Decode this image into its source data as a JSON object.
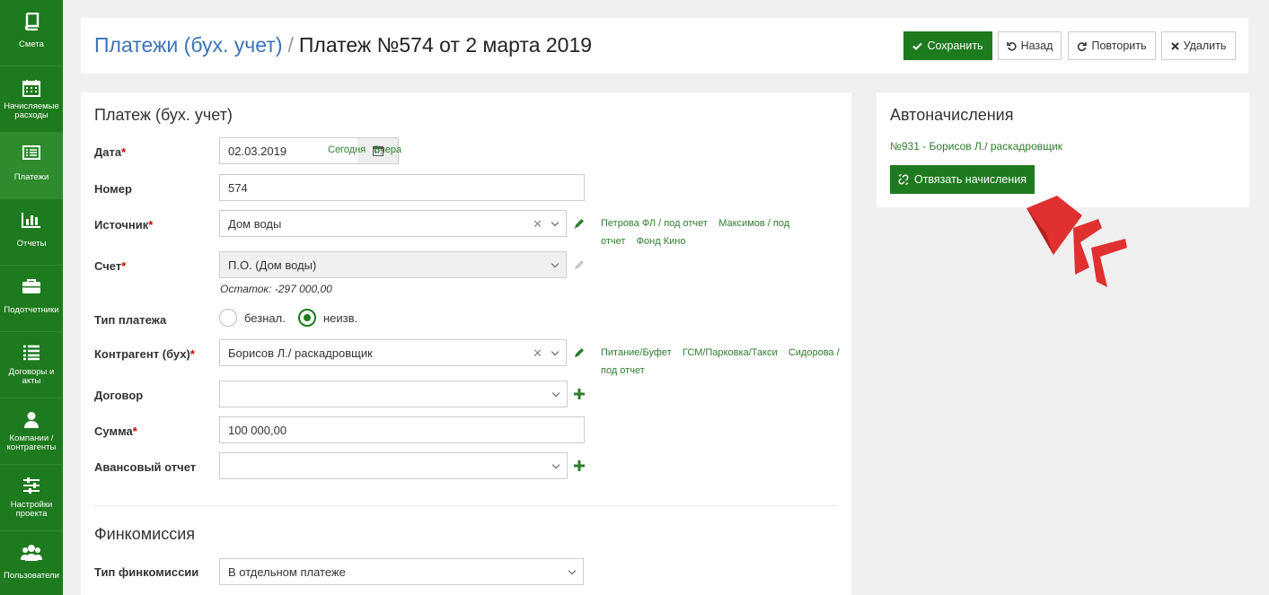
{
  "sidebar": {
    "items": [
      {
        "label": "Смета",
        "icon": "book-icon"
      },
      {
        "label": "Начисляемые расходы",
        "icon": "calendar-icon"
      },
      {
        "label": "Платежи",
        "icon": "list-card-icon"
      },
      {
        "label": "Отчеты",
        "icon": "bar-chart-icon"
      },
      {
        "label": "Подотчетники",
        "icon": "briefcase-icon"
      },
      {
        "label": "Договоры и акты",
        "icon": "list-icon"
      },
      {
        "label": "Компании / контрагенты",
        "icon": "user-icon"
      },
      {
        "label": "Настройки проекта",
        "icon": "sliders-icon"
      },
      {
        "label": "Пользователи",
        "icon": "users-icon"
      }
    ]
  },
  "header": {
    "breadcrumb": "Платежи (бух. учет)",
    "separator": "/",
    "title": "Платеж №574 от 2 марта 2019",
    "buttons": {
      "save": "Сохранить",
      "back": "Назад",
      "repeat": "Повторить",
      "delete": "Удалить"
    }
  },
  "form": {
    "title": "Платеж (бух. учет)",
    "date": {
      "label": "Дата",
      "value": "02.03.2019",
      "today": "Сегодня",
      "yesterday": "Вчера"
    },
    "number": {
      "label": "Номер",
      "value": "574"
    },
    "source": {
      "label": "Источник",
      "value": "Дом воды",
      "quick_links": [
        "Петрова ФЛ / под отчет",
        "Максимов / под отчет",
        "Фонд Кино"
      ]
    },
    "account": {
      "label": "Счет",
      "value": "П.О. (Дом воды)",
      "balance": "Остаток: -297 000,00"
    },
    "payment_type": {
      "label": "Тип платежа",
      "options": [
        "безнал.",
        "неизв."
      ],
      "selected": "неизв."
    },
    "counterparty": {
      "label": "Контрагент (бух)",
      "value": "Борисов Л./ раскадровщик",
      "quick_links": [
        "Питание/Буфет",
        "ГСМ/Парковка/Такси",
        "Сидорова / под отчет"
      ]
    },
    "contract": {
      "label": "Договор",
      "value": ""
    },
    "sum": {
      "label": "Сумма",
      "value": "100 000,00"
    },
    "advance_report": {
      "label": "Авансовый отчет",
      "value": ""
    },
    "required_mark": "*"
  },
  "fincommission": {
    "title": "Финкомиссия",
    "type": {
      "label": "Тип финкомиссии",
      "value": "В отдельном платеже"
    }
  },
  "autocharges": {
    "title": "Автоначисления",
    "link": "№931 - Борисов Л./ раскадровщик",
    "unlink_button": "Отвязать начисления"
  },
  "colors": {
    "brand": "#1e7a1e",
    "link": "#3a73b8",
    "decor": "#e03030"
  }
}
